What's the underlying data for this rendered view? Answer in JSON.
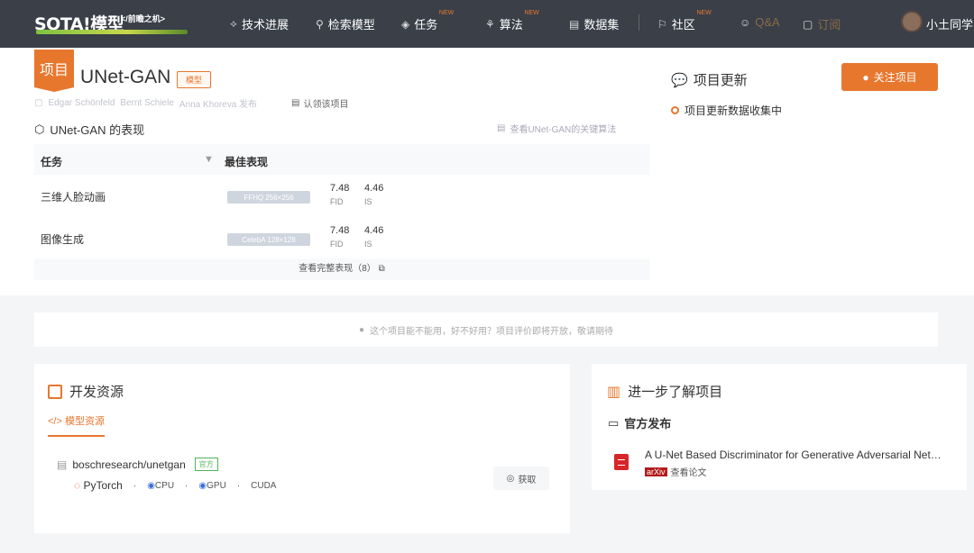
{
  "header": {
    "logo_text": "SOTA!模型",
    "logo_tag": "</前瞻之机>",
    "nav": [
      {
        "icon": "⟡",
        "label": "技术进展",
        "badge": ""
      },
      {
        "icon": "⚲",
        "label": "检索模型",
        "badge": ""
      },
      {
        "icon": "◈",
        "label": "任务",
        "badge": "NEW"
      },
      {
        "icon": "⚘",
        "label": "算法",
        "badge": "NEW"
      },
      {
        "icon": "▤",
        "label": "数据集",
        "badge": ""
      },
      {
        "icon": "⚐",
        "label": "社区",
        "badge": "NEW"
      },
      {
        "icon": "☺",
        "label": "Q&A",
        "badge": ""
      },
      {
        "icon": "▢",
        "label": "订阅",
        "badge": ""
      }
    ],
    "username": "小土同学"
  },
  "project": {
    "badge": "项目",
    "title": "UNet-GAN",
    "type_tag": "模型",
    "meta": [
      "Edgar Schönfeld",
      "Bernt Schiele",
      "Anna Khoreva 发布"
    ],
    "claim": "认领该项目",
    "perf_heading": "UNet-GAN 的表现",
    "perf_link": "查看UNet-GAN的关键算法"
  },
  "perf_table": {
    "col_task": "任务",
    "col_best": "最佳表现",
    "rows": [
      {
        "task": "三维人脸动画",
        "bench": "FFHQ 256×256",
        "metrics": [
          {
            "value": "7.48",
            "name": "FID"
          },
          {
            "value": "4.46",
            "name": "IS"
          }
        ]
      },
      {
        "task": "图像生成",
        "bench": "CelebA 128×128",
        "metrics": [
          {
            "value": "7.48",
            "name": "FID"
          },
          {
            "value": "4.46",
            "name": "IS"
          }
        ]
      }
    ],
    "more": "查看完整表现（8）"
  },
  "updates": {
    "title": "项目更新",
    "follow": "关注项目",
    "item": "项目更新数据收集中"
  },
  "notice": "这个项目能不能用，好不好用？项目评价即将开放，敬请期待",
  "dev": {
    "title": "开发资源",
    "tab": "</> 模型资源",
    "repo": "boschresearch/unetgan",
    "official": "官方",
    "framework": "PyTorch",
    "tech": [
      "CPU",
      "GPU",
      "CUDA"
    ],
    "get": "获取"
  },
  "learn": {
    "title": "进一步了解项目",
    "official_heading": "官方发布",
    "paper_title": "A U-Net Based Discriminator for Generative Adversarial Networks",
    "arxiv": "arXiv",
    "read": "查看论文"
  }
}
